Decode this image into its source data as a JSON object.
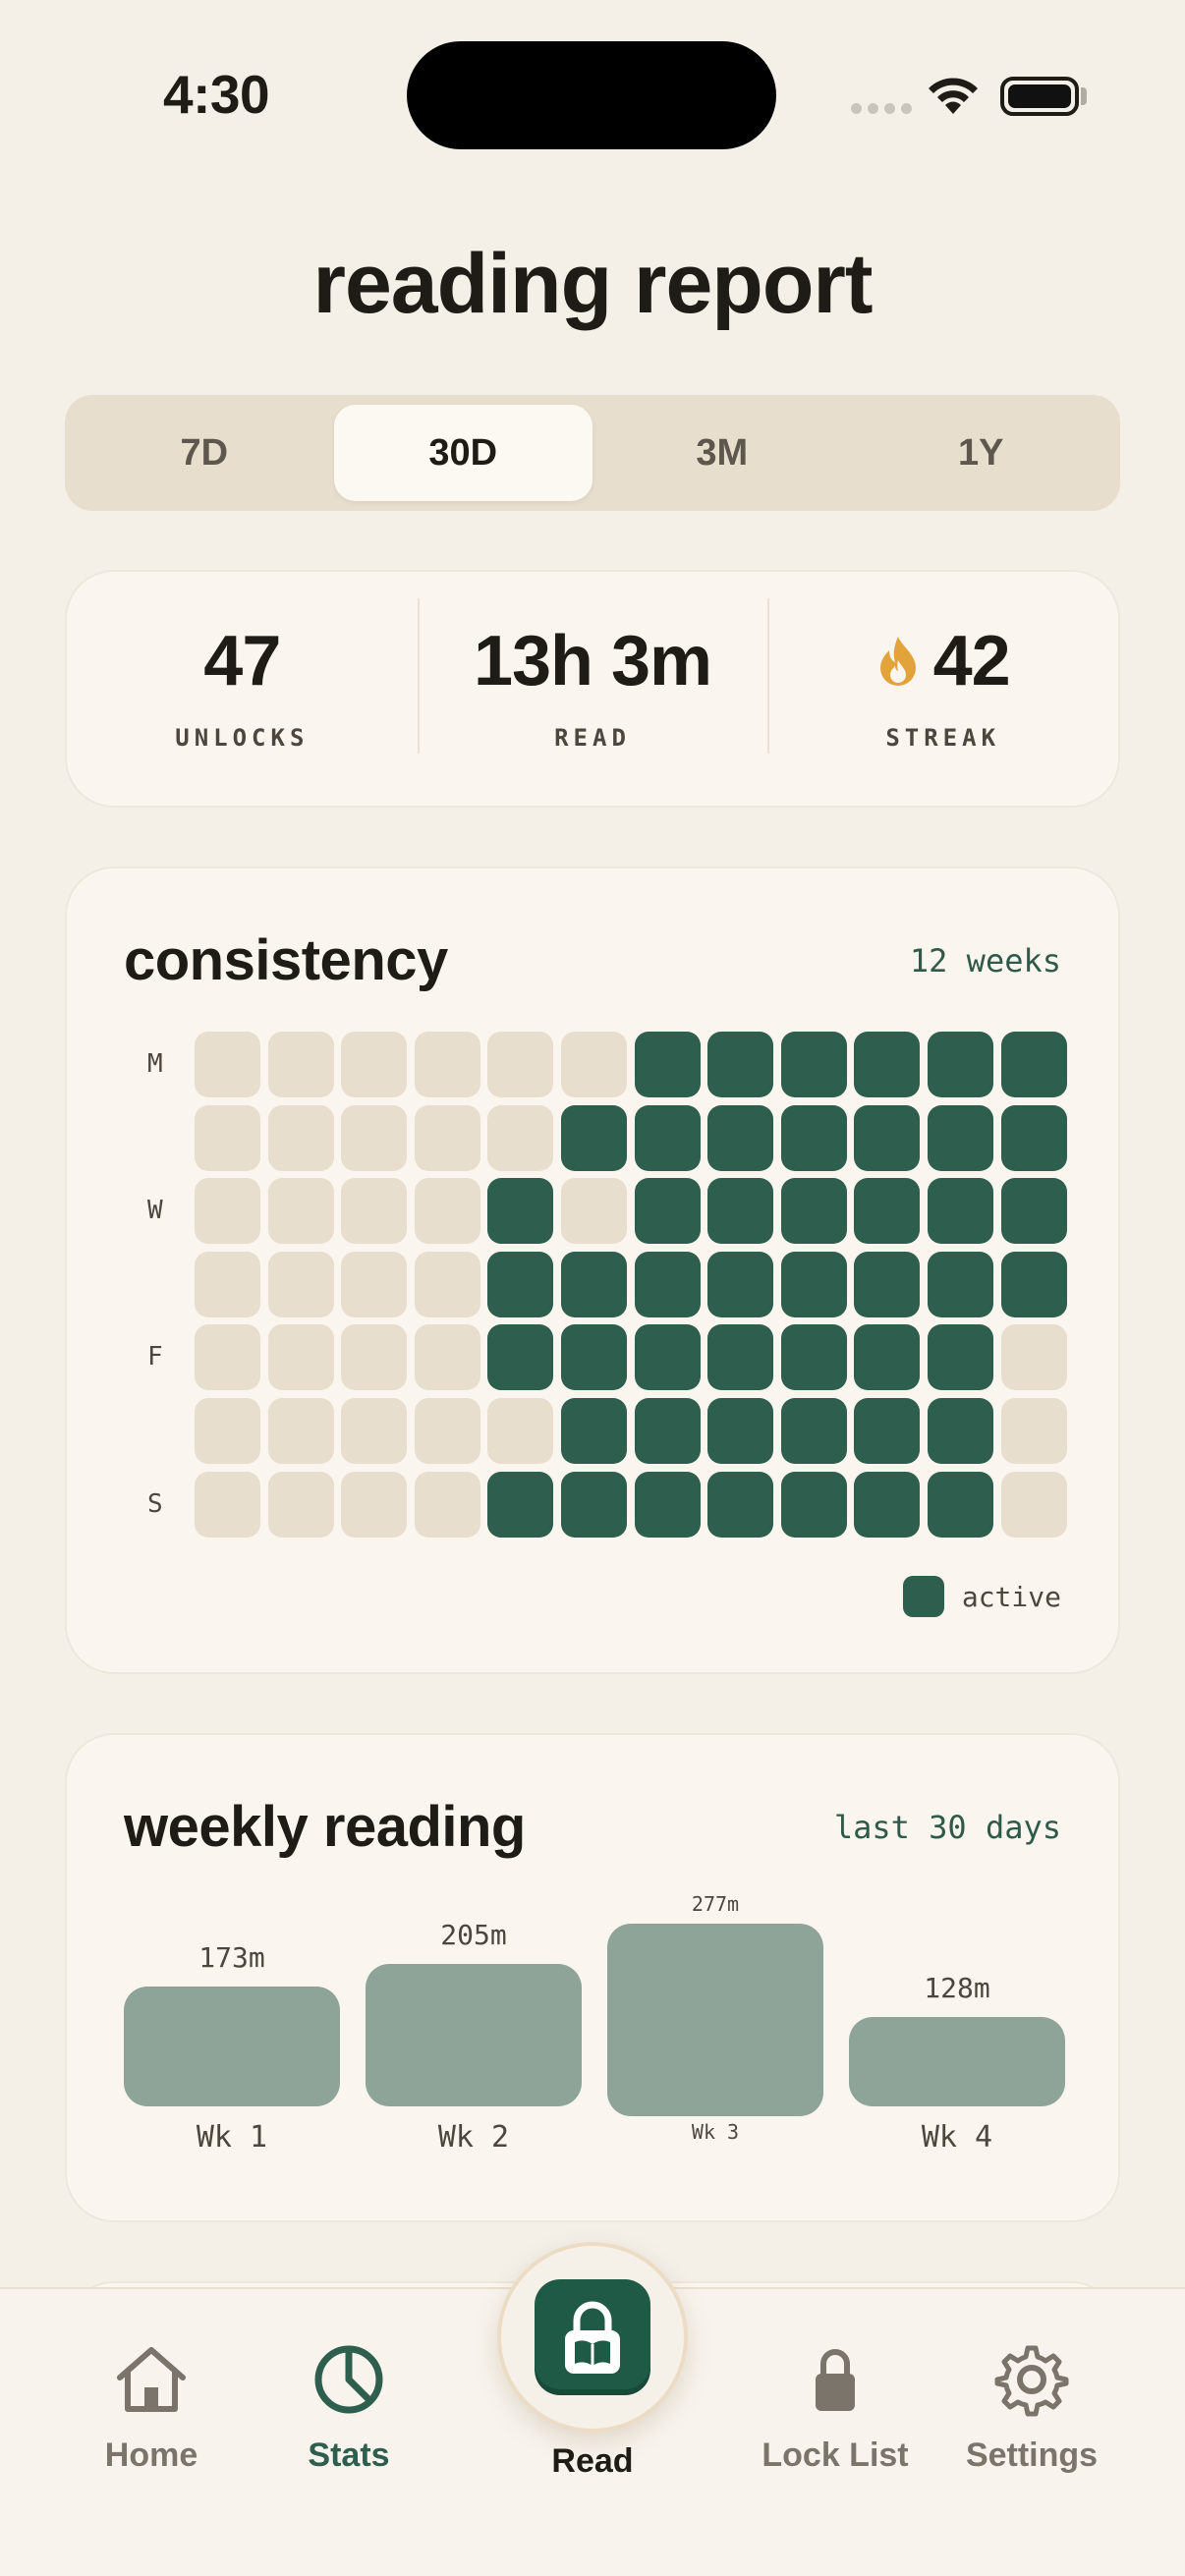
{
  "status_bar": {
    "time": "4:30"
  },
  "title": "reading report",
  "range_tabs": [
    {
      "label": "7D",
      "active": false
    },
    {
      "label": "30D",
      "active": true
    },
    {
      "label": "3M",
      "active": false
    },
    {
      "label": "1Y",
      "active": false
    }
  ],
  "stats": {
    "unlocks": {
      "value": "47",
      "label": "UNLOCKS"
    },
    "read": {
      "value": "13h 3m",
      "label": "READ"
    },
    "streak": {
      "value": "42",
      "label": "STREAK",
      "icon": "flame-icon"
    }
  },
  "consistency": {
    "title": "consistency",
    "meta": "12 weeks",
    "day_labels": [
      "M",
      "",
      "W",
      "",
      "F",
      "",
      "S"
    ],
    "grid": [
      [
        0,
        0,
        0,
        0,
        0,
        0,
        1,
        1,
        1,
        1,
        1,
        1
      ],
      [
        0,
        0,
        0,
        0,
        0,
        1,
        1,
        1,
        1,
        1,
        1,
        1
      ],
      [
        0,
        0,
        0,
        0,
        1,
        0,
        1,
        1,
        1,
        1,
        1,
        1
      ],
      [
        0,
        0,
        0,
        0,
        1,
        1,
        1,
        1,
        1,
        1,
        1,
        1
      ],
      [
        0,
        0,
        0,
        0,
        1,
        1,
        1,
        1,
        1,
        1,
        1,
        0
      ],
      [
        0,
        0,
        0,
        0,
        0,
        1,
        1,
        1,
        1,
        1,
        1,
        0
      ],
      [
        0,
        0,
        0,
        0,
        1,
        1,
        1,
        1,
        1,
        1,
        1,
        0
      ]
    ],
    "legend": "active",
    "colors": {
      "active": "#2e5e4e",
      "inactive": "#e8dece"
    }
  },
  "weekly": {
    "title": "weekly reading",
    "meta": "last 30 days",
    "chart_data": {
      "type": "bar",
      "categories": [
        "Wk 1",
        "Wk 2",
        "Wk 3",
        "Wk 4"
      ],
      "values": [
        173,
        205,
        277,
        128
      ],
      "value_labels": [
        "173m",
        "205m",
        "277m",
        "128m"
      ],
      "title": "weekly reading",
      "subtitle": "last 30 days"
    }
  },
  "tabs": [
    {
      "label": "Home",
      "icon": "home-icon",
      "active": false
    },
    {
      "label": "Stats",
      "icon": "pie-chart-icon",
      "active": true
    },
    {
      "label": "Read",
      "icon": "lock-book-icon",
      "active": false
    },
    {
      "label": "Lock List",
      "icon": "lock-icon",
      "active": false
    },
    {
      "label": "Settings",
      "icon": "gear-icon",
      "active": false
    }
  ]
}
